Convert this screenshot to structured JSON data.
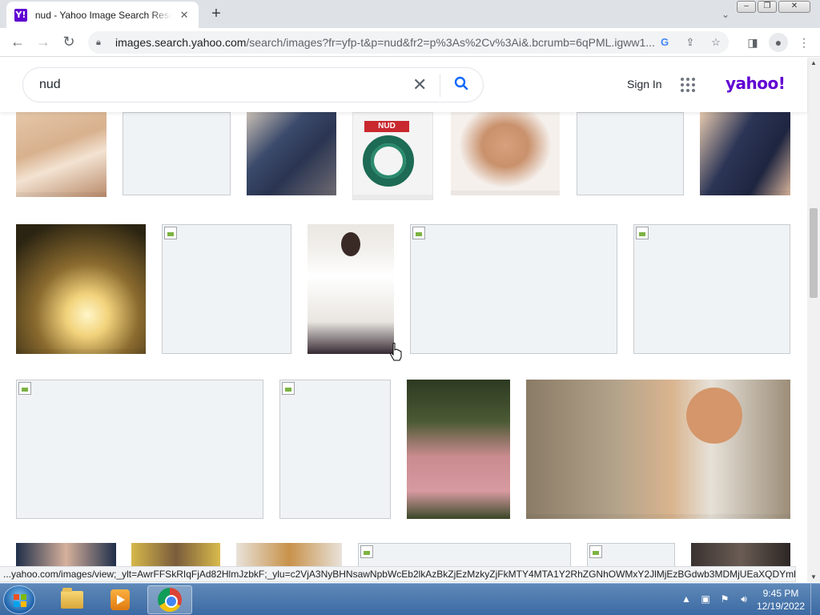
{
  "browser": {
    "tab": {
      "favicon_letter": "Y!",
      "title": "nud - Yahoo Image Search Results",
      "close_glyph": "✕"
    },
    "new_tab_glyph": "+",
    "url_host": "images.search.yahoo.com",
    "url_path": "/search/images?fr=yfp-t&p=nud&fr2=p%3As%2Cv%3Ai&.bcrumb=6qPML.igww1...",
    "omnibox_icons": [
      "google-lens-icon",
      "share-icon",
      "star-icon"
    ],
    "status_url": "...yahoo.com/images/view;_ylt=AwrFFSkRIqFjAd82HlmJzbkF;_ylu=c2VjA3NyBHNsawNpbWcEb2lkAzBkZjEzMzkyZjFkMTY4MTA1Y2RhZGNhOWMxY2JlMjEzBGdwb3MDMjUEaXQDYmluZw..."
  },
  "yahoo": {
    "search_query": "nud",
    "sign_in_label": "Sign In",
    "logo_text": "yahoo!",
    "colors": {
      "brand_purple": "#6001d2",
      "search_blue": "#0f69ff"
    }
  },
  "results": {
    "tiles": [
      {
        "id": "r1-1",
        "kind": "image",
        "desc": "woman-in-lingerie-photo"
      },
      {
        "id": "r1-2",
        "kind": "broken"
      },
      {
        "id": "r1-3",
        "kind": "image",
        "desc": "person-in-plaid-shirt-photo"
      },
      {
        "id": "r1-4",
        "kind": "image",
        "desc": "green-rope-product-photo",
        "overlay_text": "NUD"
      },
      {
        "id": "r1-5",
        "kind": "image",
        "desc": "woman-in-nude-bodysuit-photo"
      },
      {
        "id": "r1-6",
        "kind": "broken"
      },
      {
        "id": "r1-7",
        "kind": "image",
        "desc": "person-in-plaid-skirt-photo"
      },
      {
        "id": "r2-1",
        "kind": "image",
        "desc": "hanging-edison-bulbs-photo"
      },
      {
        "id": "r2-2",
        "kind": "broken"
      },
      {
        "id": "r2-3",
        "kind": "image",
        "desc": "woman-in-white-shirt-photo"
      },
      {
        "id": "r2-4",
        "kind": "broken"
      },
      {
        "id": "r2-5",
        "kind": "broken"
      },
      {
        "id": "r3-1",
        "kind": "broken"
      },
      {
        "id": "r3-2",
        "kind": "broken"
      },
      {
        "id": "r3-3",
        "kind": "image",
        "desc": "woman-in-pink-dress-photo"
      },
      {
        "id": "r3-4",
        "kind": "image",
        "desc": "woman-in-green-white-top-photo"
      },
      {
        "id": "r4-1",
        "kind": "image",
        "desc": "woman-portrait-photo"
      },
      {
        "id": "r4-2",
        "kind": "image",
        "desc": "woman-yellow-background-photo"
      },
      {
        "id": "r4-3",
        "kind": "image",
        "desc": "woman-blonde-photo"
      },
      {
        "id": "r4-4",
        "kind": "broken"
      },
      {
        "id": "r4-5",
        "kind": "broken"
      },
      {
        "id": "r4-6",
        "kind": "image",
        "desc": "dark-photo"
      }
    ]
  },
  "taskbar": {
    "time": "9:45 PM",
    "date": "12/19/2022",
    "tray_icons": [
      "show-hidden-icons-icon",
      "network-icon",
      "action-center-icon",
      "volume-icon"
    ]
  }
}
